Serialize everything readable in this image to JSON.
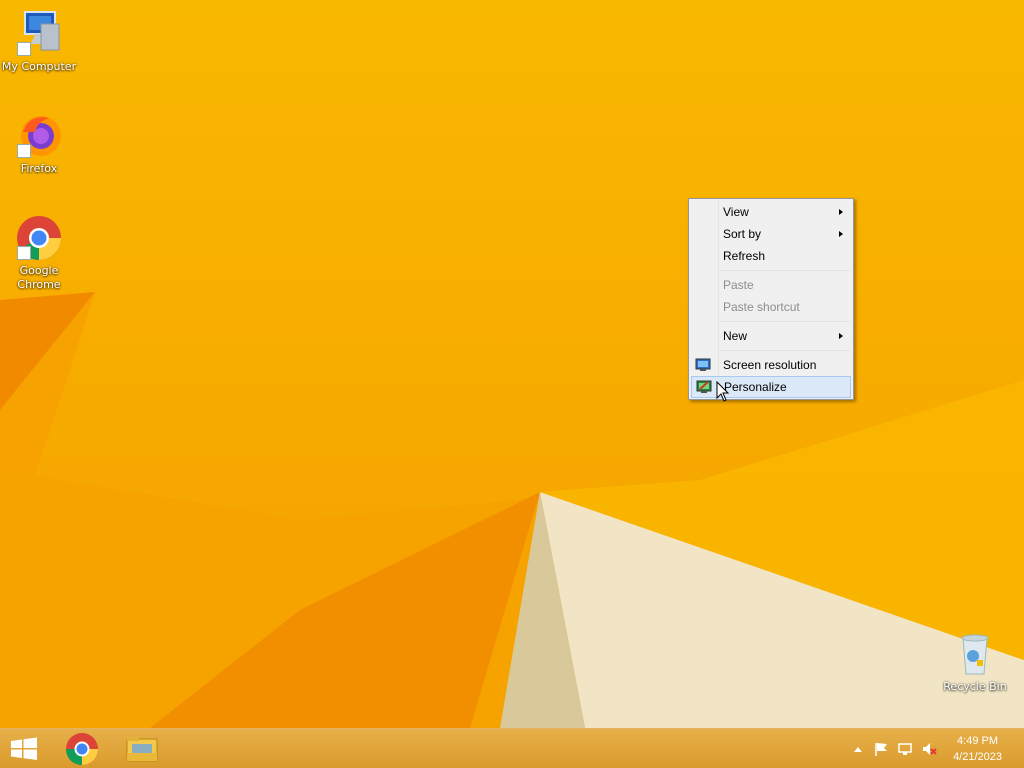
{
  "desktop_icons": [
    {
      "label": "My Computer",
      "icon": "computer-icon"
    },
    {
      "label": "Firefox",
      "icon": "firefox-icon"
    },
    {
      "label": "Google Chrome",
      "icon": "chrome-icon"
    },
    {
      "label": "Recycle Bin",
      "icon": "recycle-bin-icon"
    }
  ],
  "context_menu": {
    "items": [
      {
        "label": "View",
        "submenu": true,
        "enabled": true
      },
      {
        "label": "Sort by",
        "submenu": true,
        "enabled": true
      },
      {
        "label": "Refresh",
        "submenu": false,
        "enabled": true
      },
      {
        "label": "Paste",
        "submenu": false,
        "enabled": false
      },
      {
        "label": "Paste shortcut",
        "submenu": false,
        "enabled": false
      },
      {
        "label": "New",
        "submenu": true,
        "enabled": true
      },
      {
        "label": "Screen resolution",
        "submenu": false,
        "enabled": true,
        "icon": "monitor-icon"
      },
      {
        "label": "Personalize",
        "submenu": false,
        "enabled": true,
        "icon": "personalize-icon",
        "highlighted": true
      }
    ]
  },
  "taskbar": {
    "buttons": [
      {
        "name": "start",
        "icon": "windows-logo-icon"
      },
      {
        "name": "chrome",
        "icon": "chrome-icon"
      },
      {
        "name": "file-explorer",
        "icon": "folder-icon"
      }
    ],
    "tray_icons": [
      "chevron-up-icon",
      "flag-icon",
      "network-icon",
      "speaker-muted-icon"
    ],
    "clock": {
      "time": "4:49 PM",
      "date": "4/21/2023"
    }
  },
  "colors": {
    "wallpaper": "#f8b000",
    "menu_highlight": "#dbe8f8",
    "menu_disabled": "#8d8d8d"
  }
}
